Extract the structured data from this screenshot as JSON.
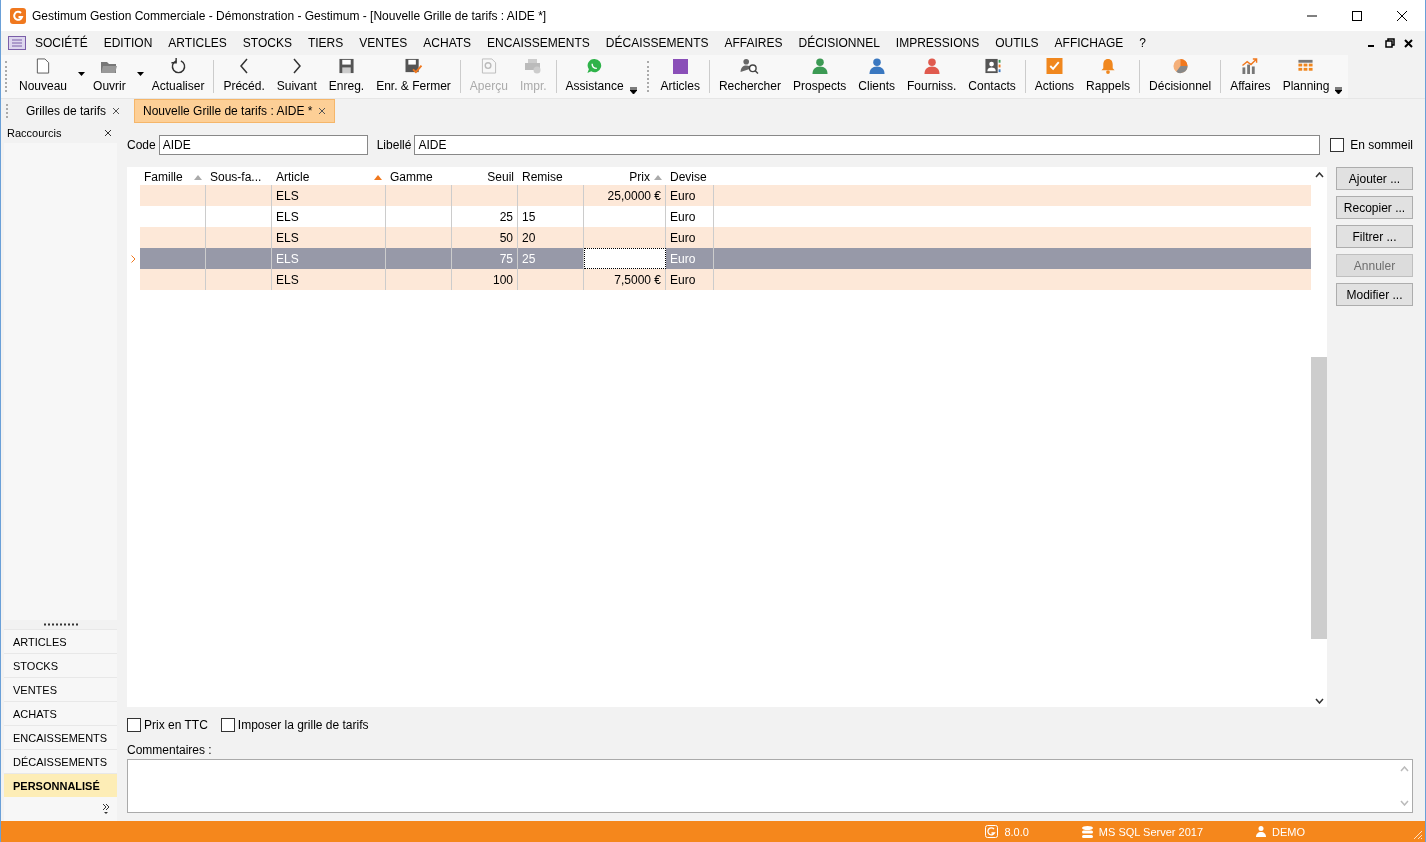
{
  "window": {
    "title": "Gestimum Gestion Commerciale - Démonstration - Gestimum - [Nouvelle Grille de tarifs : AIDE *]"
  },
  "menu": [
    "SOCIÉTÉ",
    "EDITION",
    "ARTICLES",
    "STOCKS",
    "TIERS",
    "VENTES",
    "ACHATS",
    "ENCAISSEMENTS",
    "DÉCAISSEMENTS",
    "AFFAIRES",
    "DÉCISIONNEL",
    "IMPRESSIONS",
    "OUTILS",
    "AFFICHAGE",
    "?"
  ],
  "toolbar": [
    {
      "label": "Nouveau",
      "kind": "new",
      "dropdown": true,
      "disabled": false,
      "separator_before": false
    },
    {
      "label": "Ouvrir",
      "kind": "open",
      "dropdown": true,
      "disabled": false,
      "separator_before": false
    },
    {
      "label": "Actualiser",
      "kind": "refresh",
      "dropdown": false,
      "disabled": false,
      "separator_before": false
    },
    {
      "label": "Précéd.",
      "kind": "prev",
      "dropdown": false,
      "disabled": false,
      "separator_before": true
    },
    {
      "label": "Suivant",
      "kind": "next",
      "dropdown": false,
      "disabled": false,
      "separator_before": false
    },
    {
      "label": "Enreg.",
      "kind": "save",
      "dropdown": false,
      "disabled": false,
      "separator_before": false
    },
    {
      "label": "Enr. & Fermer",
      "kind": "save-close",
      "dropdown": false,
      "disabled": false,
      "separator_before": false
    },
    {
      "label": "Aperçu",
      "kind": "preview",
      "dropdown": false,
      "disabled": true,
      "separator_before": true
    },
    {
      "label": "Impr.",
      "kind": "print",
      "dropdown": false,
      "disabled": true,
      "separator_before": false
    },
    {
      "label": "Assistance",
      "kind": "chat",
      "dropdown": false,
      "disabled": false,
      "separator_before": true,
      "overflow_after": true
    },
    {
      "label": "Articles",
      "kind": "square",
      "dropdown": false,
      "disabled": false,
      "separator_before": false,
      "band_start": true
    },
    {
      "label": "Rechercher",
      "kind": "search-person",
      "dropdown": false,
      "disabled": false,
      "separator_before": true
    },
    {
      "label": "Prospects",
      "kind": "person",
      "color": "#3c9a54",
      "dropdown": false,
      "disabled": false,
      "separator_before": false
    },
    {
      "label": "Clients",
      "kind": "person",
      "color": "#3a78c0",
      "dropdown": false,
      "disabled": false,
      "separator_before": false
    },
    {
      "label": "Fourniss.",
      "kind": "person",
      "color": "#e05a4e",
      "dropdown": false,
      "disabled": false,
      "separator_before": false
    },
    {
      "label": "Contacts",
      "kind": "contact",
      "dropdown": false,
      "disabled": false,
      "separator_before": false
    },
    {
      "label": "Actions",
      "kind": "task",
      "dropdown": false,
      "disabled": false,
      "separator_before": true
    },
    {
      "label": "Rappels",
      "kind": "bell",
      "dropdown": false,
      "disabled": false,
      "separator_before": false
    },
    {
      "label": "Décisionnel",
      "kind": "pie",
      "dropdown": false,
      "disabled": false,
      "separator_before": true
    },
    {
      "label": "Affaires",
      "kind": "chart",
      "dropdown": false,
      "disabled": false,
      "separator_before": true
    },
    {
      "label": "Planning",
      "kind": "calendar",
      "dropdown": false,
      "disabled": false,
      "separator_before": false,
      "overflow_after": true
    }
  ],
  "doc_tabs": [
    {
      "label": "Grilles de tarifs",
      "selected": false
    },
    {
      "label": "Nouvelle Grille de tarifs : AIDE *",
      "selected": true
    }
  ],
  "sidebar": {
    "title": "Raccourcis",
    "items": [
      {
        "label": "ARTICLES",
        "selected": false
      },
      {
        "label": "STOCKS",
        "selected": false
      },
      {
        "label": "VENTES",
        "selected": false
      },
      {
        "label": "ACHATS",
        "selected": false
      },
      {
        "label": "ENCAISSEMENTS",
        "selected": false
      },
      {
        "label": "DÉCAISSEMENTS",
        "selected": false
      },
      {
        "label": "PERSONNALISÉ",
        "selected": true
      }
    ]
  },
  "form": {
    "code_label": "Code",
    "code_value": "AIDE",
    "libelle_label": "Libellé",
    "libelle_value": "AIDE",
    "sleep": {
      "label": "En sommeil",
      "checked": false
    }
  },
  "table": {
    "columns": [
      {
        "label": "Famille",
        "numeric": false,
        "sort_arrow": true,
        "sort_active": false
      },
      {
        "label": "Sous-fa...",
        "numeric": false
      },
      {
        "label": "Article",
        "numeric": false,
        "sort_arrow": true,
        "sort_active": true
      },
      {
        "label": "Gamme",
        "numeric": false
      },
      {
        "label": "Seuil",
        "numeric": true
      },
      {
        "label": "Remise",
        "numeric": false
      },
      {
        "label": "Prix",
        "numeric": true,
        "sort_arrow": true,
        "sort_active": false,
        "editor": true
      },
      {
        "label": "Devise",
        "numeric": false
      }
    ],
    "rows": [
      {
        "selected": false,
        "editing": false,
        "cells": [
          "",
          "",
          "ELS",
          "",
          "",
          "",
          "25,0000 €",
          "Euro"
        ]
      },
      {
        "selected": false,
        "editing": false,
        "cells": [
          "",
          "",
          "ELS",
          "",
          "25",
          "15",
          "",
          "Euro"
        ]
      },
      {
        "selected": false,
        "editing": false,
        "cells": [
          "",
          "",
          "ELS",
          "",
          "50",
          "20",
          "",
          "Euro"
        ]
      },
      {
        "selected": true,
        "editing": true,
        "cells": [
          "",
          "",
          "ELS",
          "",
          "75",
          "25",
          "",
          "Euro"
        ]
      },
      {
        "selected": false,
        "editing": false,
        "cells": [
          "",
          "",
          "ELS",
          "",
          "100",
          "",
          "7,5000 €",
          "Euro"
        ]
      }
    ]
  },
  "side_buttons": [
    {
      "label": "Ajouter ...",
      "disabled": false
    },
    {
      "label": "Recopier ...",
      "disabled": false
    },
    {
      "label": "Filtrer ...",
      "disabled": false
    },
    {
      "label": "Annuler",
      "disabled": true
    },
    {
      "label": "Modifier ...",
      "disabled": false
    }
  ],
  "options": [
    {
      "label": "Prix en TTC",
      "checked": false
    },
    {
      "label": "Imposer la grille de tarifs",
      "checked": false
    }
  ],
  "comments": {
    "label": "Commentaires :"
  },
  "status_bar": {
    "version": "8.0.0",
    "database": "MS SQL Server 2017",
    "user": "DEMO"
  }
}
